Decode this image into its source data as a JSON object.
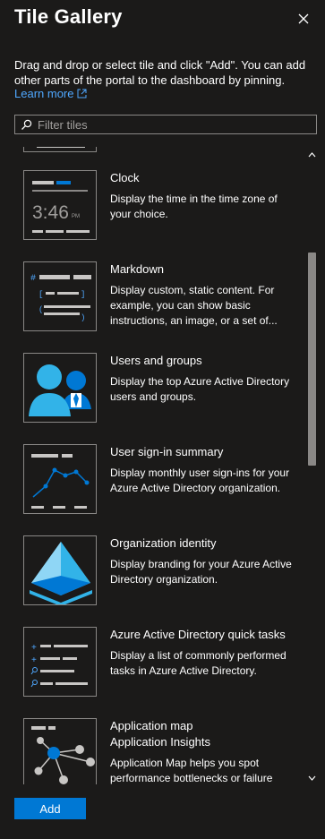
{
  "panel": {
    "title": "Tile Gallery",
    "description": "Drag and drop or select tile and click \"Add\". You can add other parts of the portal to the dashboard by pinning.",
    "learn_more": "Learn more"
  },
  "search": {
    "placeholder": "Filter tiles"
  },
  "tiles": [
    {
      "title": "Clock",
      "description": "Display the time in the time zone of your choice.",
      "thumb_time": "3:46",
      "thumb_ampm": "PM"
    },
    {
      "title": "Markdown",
      "description": "Display custom, static content. For example, you can show basic instructions, an image, or a set of..."
    },
    {
      "title": "Users and groups",
      "description": "Display the top Azure Active Directory users and groups."
    },
    {
      "title": "User sign-in summary",
      "description": "Display monthly user sign-ins for your Azure Active Directory organization."
    },
    {
      "title": "Organization identity",
      "description": "Display branding for your Azure Active Directory organization."
    },
    {
      "title": "Azure Active Directory quick tasks",
      "description": "Display a list of commonly performed tasks in Azure Active Directory."
    },
    {
      "title": "Application map",
      "subtitle": "Application Insights",
      "description": "Application Map helps you spot performance bottlenecks or failure"
    }
  ],
  "footer": {
    "add_label": "Add"
  },
  "colors": {
    "accent": "#0078d4",
    "link": "#4fa8ff",
    "background": "#1b1a19"
  }
}
